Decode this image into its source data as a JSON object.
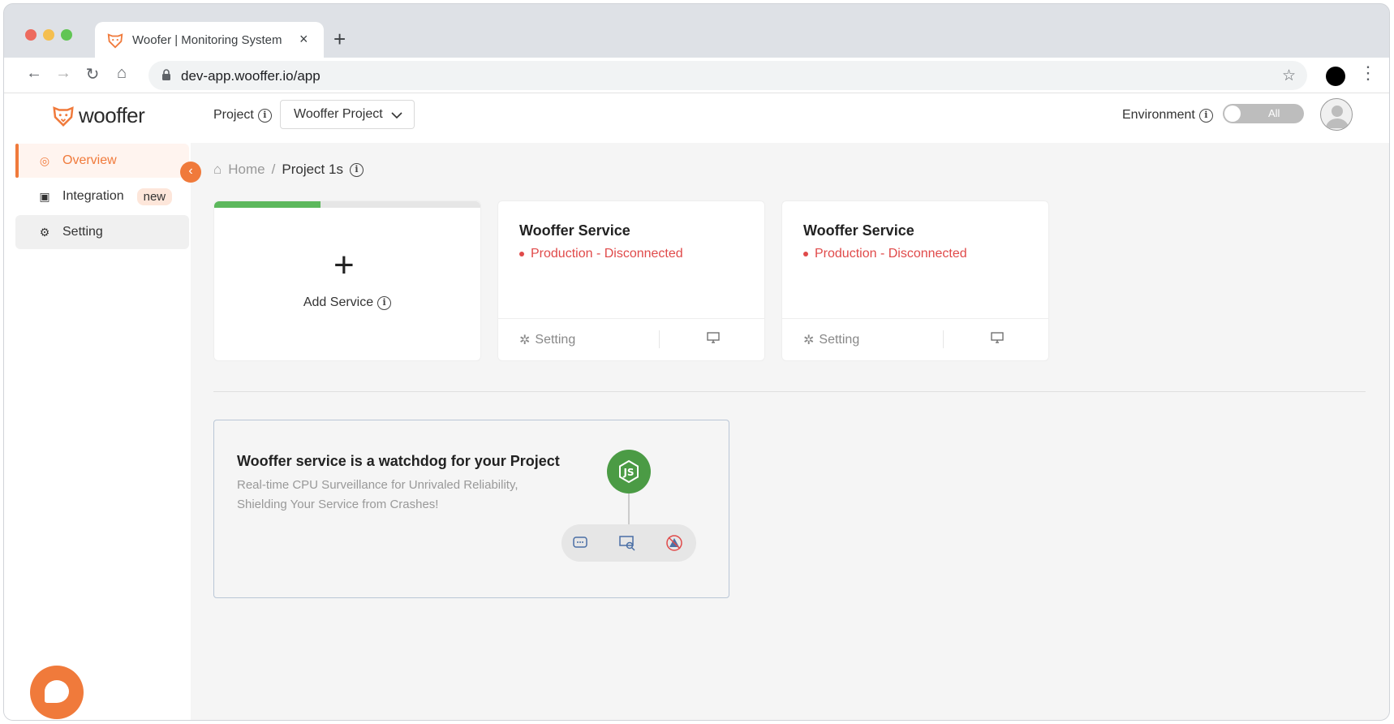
{
  "browser": {
    "tab_title": "Woofer | Monitoring System",
    "url": "dev-app.wooffer.io/app"
  },
  "app": {
    "logo_text": "wooffer",
    "header": {
      "project_label": "Project",
      "project_value": "Wooffer Project",
      "environment_label": "Environment",
      "environment_toggle": "All"
    },
    "sidebar": {
      "items": [
        {
          "label": "Overview",
          "icon": "overview-icon"
        },
        {
          "label": "Integration",
          "icon": "integration-icon",
          "badge": "new"
        },
        {
          "label": "Setting",
          "icon": "gear-icon"
        }
      ]
    },
    "breadcrumb": {
      "home": "Home",
      "separator": "/",
      "current": "Project 1s"
    },
    "add_service": {
      "label": "Add Service",
      "progress": 0.4
    },
    "services": [
      {
        "title": "Wooffer Service",
        "status": "Production - Disconnected",
        "setting_label": "Setting"
      },
      {
        "title": "Wooffer Service",
        "status": "Production - Disconnected",
        "setting_label": "Setting"
      }
    ],
    "promo": {
      "title": "Wooffer service is a watchdog for your Project",
      "description": "Real-time CPU Surveillance for Unrivaled Reliability, Shielding Your Service from Crashes!"
    },
    "colors": {
      "accent": "#f07a3b",
      "error": "#e04a4a",
      "success": "#5cb85c",
      "node": "#4b9b45"
    }
  }
}
